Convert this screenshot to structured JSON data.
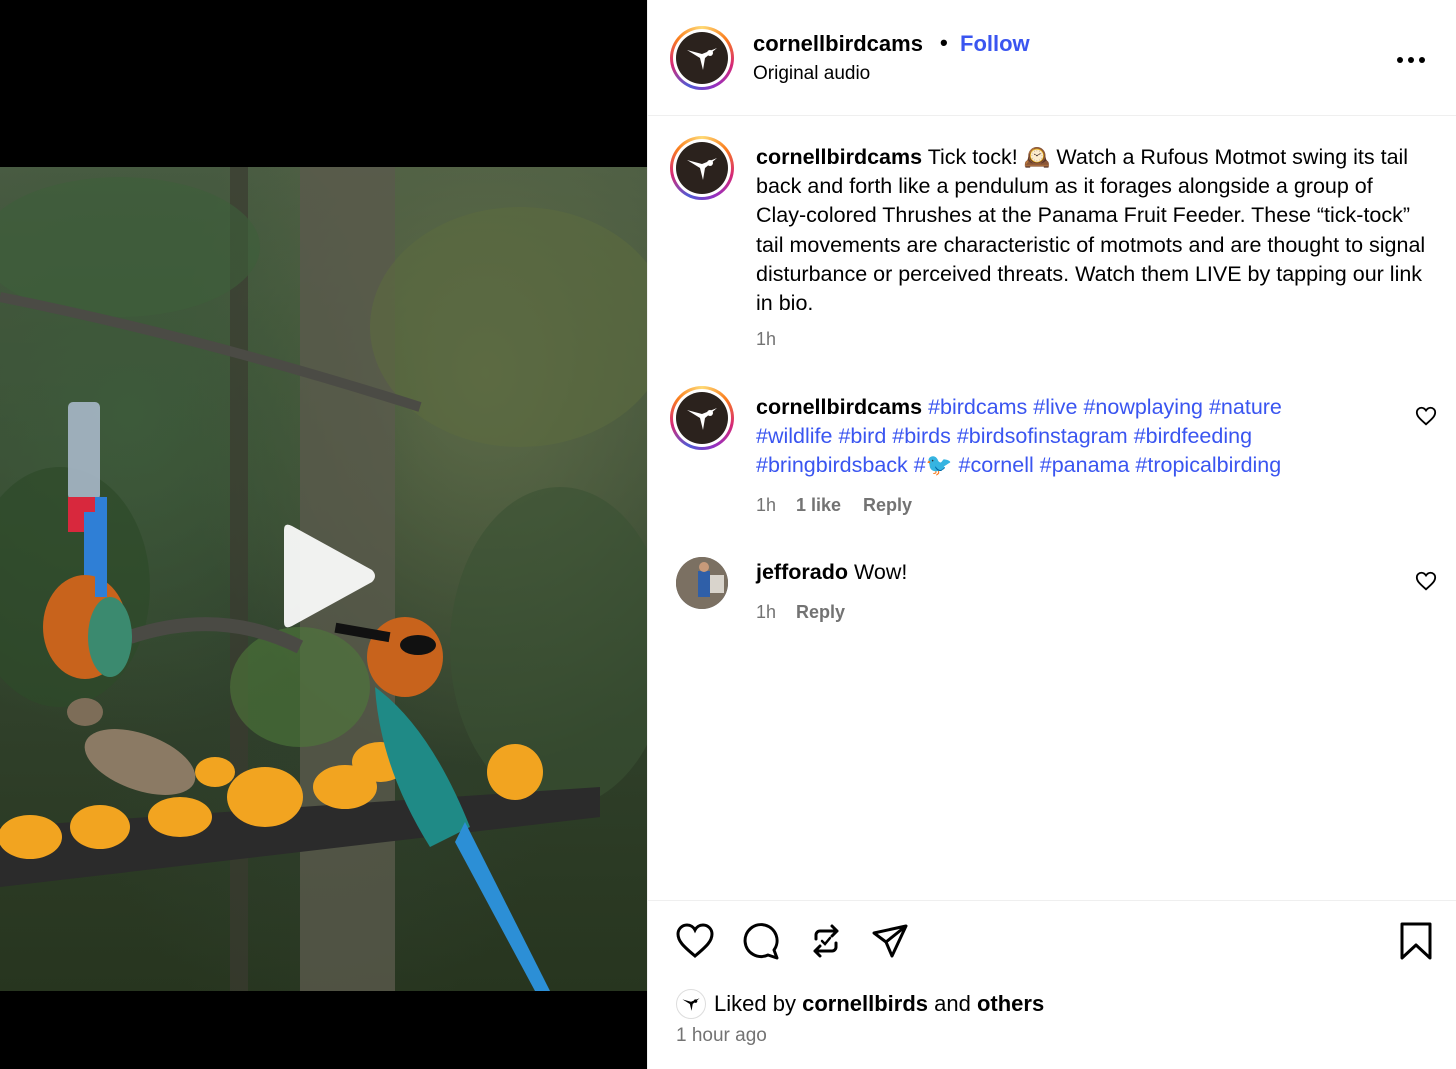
{
  "post_header": {
    "username": "cornellbirdcams",
    "separator": "•",
    "follow_label": "Follow",
    "audio_label": "Original audio"
  },
  "caption": {
    "username": "cornellbirdcams",
    "text": "Tick tock! 🕰️ Watch a Rufous Motmot swing its tail back and forth like a pendulum as it forages alongside a group of Clay-colored Thrushes at the Panama Fruit Feeder. These “tick-tock” tail movements are characteristic of motmots and are thought to signal disturbance or perceived threats. Watch them LIVE by tapping our link in bio.",
    "time": "1h"
  },
  "comments": [
    {
      "username": "cornellbirdcams",
      "tags": [
        "#birdcams",
        "#live",
        "#nowplaying",
        "#nature",
        "#wildlife",
        "#bird",
        "#birds",
        "#birdsofinstagram",
        "#birdfeeding",
        "#bringbirdsback",
        "#🐦",
        "#cornell",
        "#panama",
        "#tropicalbirding"
      ],
      "time": "1h",
      "likes": "1 like",
      "reply": "Reply"
    },
    {
      "username": "jefforado",
      "text": "Wow!",
      "time": "1h",
      "reply": "Reply"
    }
  ],
  "footer": {
    "liked_prefix": "Liked by",
    "liked_user": "cornellbirds",
    "liked_and": "and",
    "liked_others": "others",
    "time_ago": "1 hour ago"
  },
  "icons": {
    "like": "heart-icon",
    "comment": "comment-icon",
    "repost": "repost-icon",
    "share": "share-icon",
    "save": "bookmark-icon",
    "more": "more-icon",
    "play": "play-icon"
  },
  "colors": {
    "link": "#3a55f0",
    "muted": "#737373",
    "border": "#efefef"
  }
}
